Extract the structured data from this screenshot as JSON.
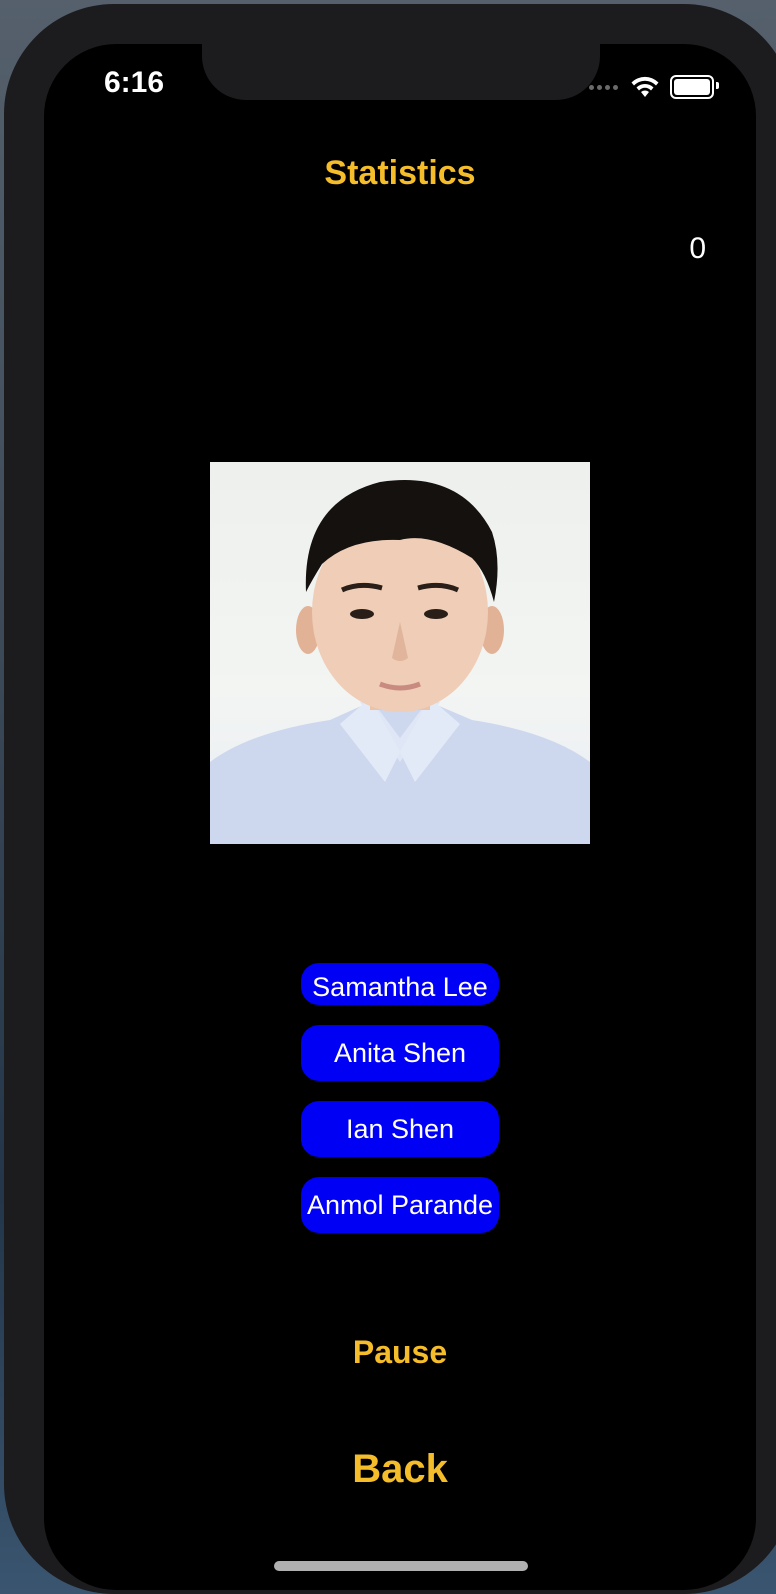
{
  "status_bar": {
    "time": "6:16",
    "icons": [
      "cellular-signal-icon",
      "wifi-icon",
      "battery-icon"
    ]
  },
  "header": {
    "title": "Statistics"
  },
  "score": "0",
  "photo": {
    "icon": "person-photo"
  },
  "choices": [
    {
      "label": "Samantha Lee"
    },
    {
      "label": "Anita Shen"
    },
    {
      "label": "Ian Shen"
    },
    {
      "label": "Anmol Parande"
    }
  ],
  "controls": {
    "pause_label": "Pause",
    "back_label": "Back"
  },
  "colors": {
    "accent": "#f5bd2a",
    "button_bg": "#0000f5",
    "background": "#000000"
  }
}
